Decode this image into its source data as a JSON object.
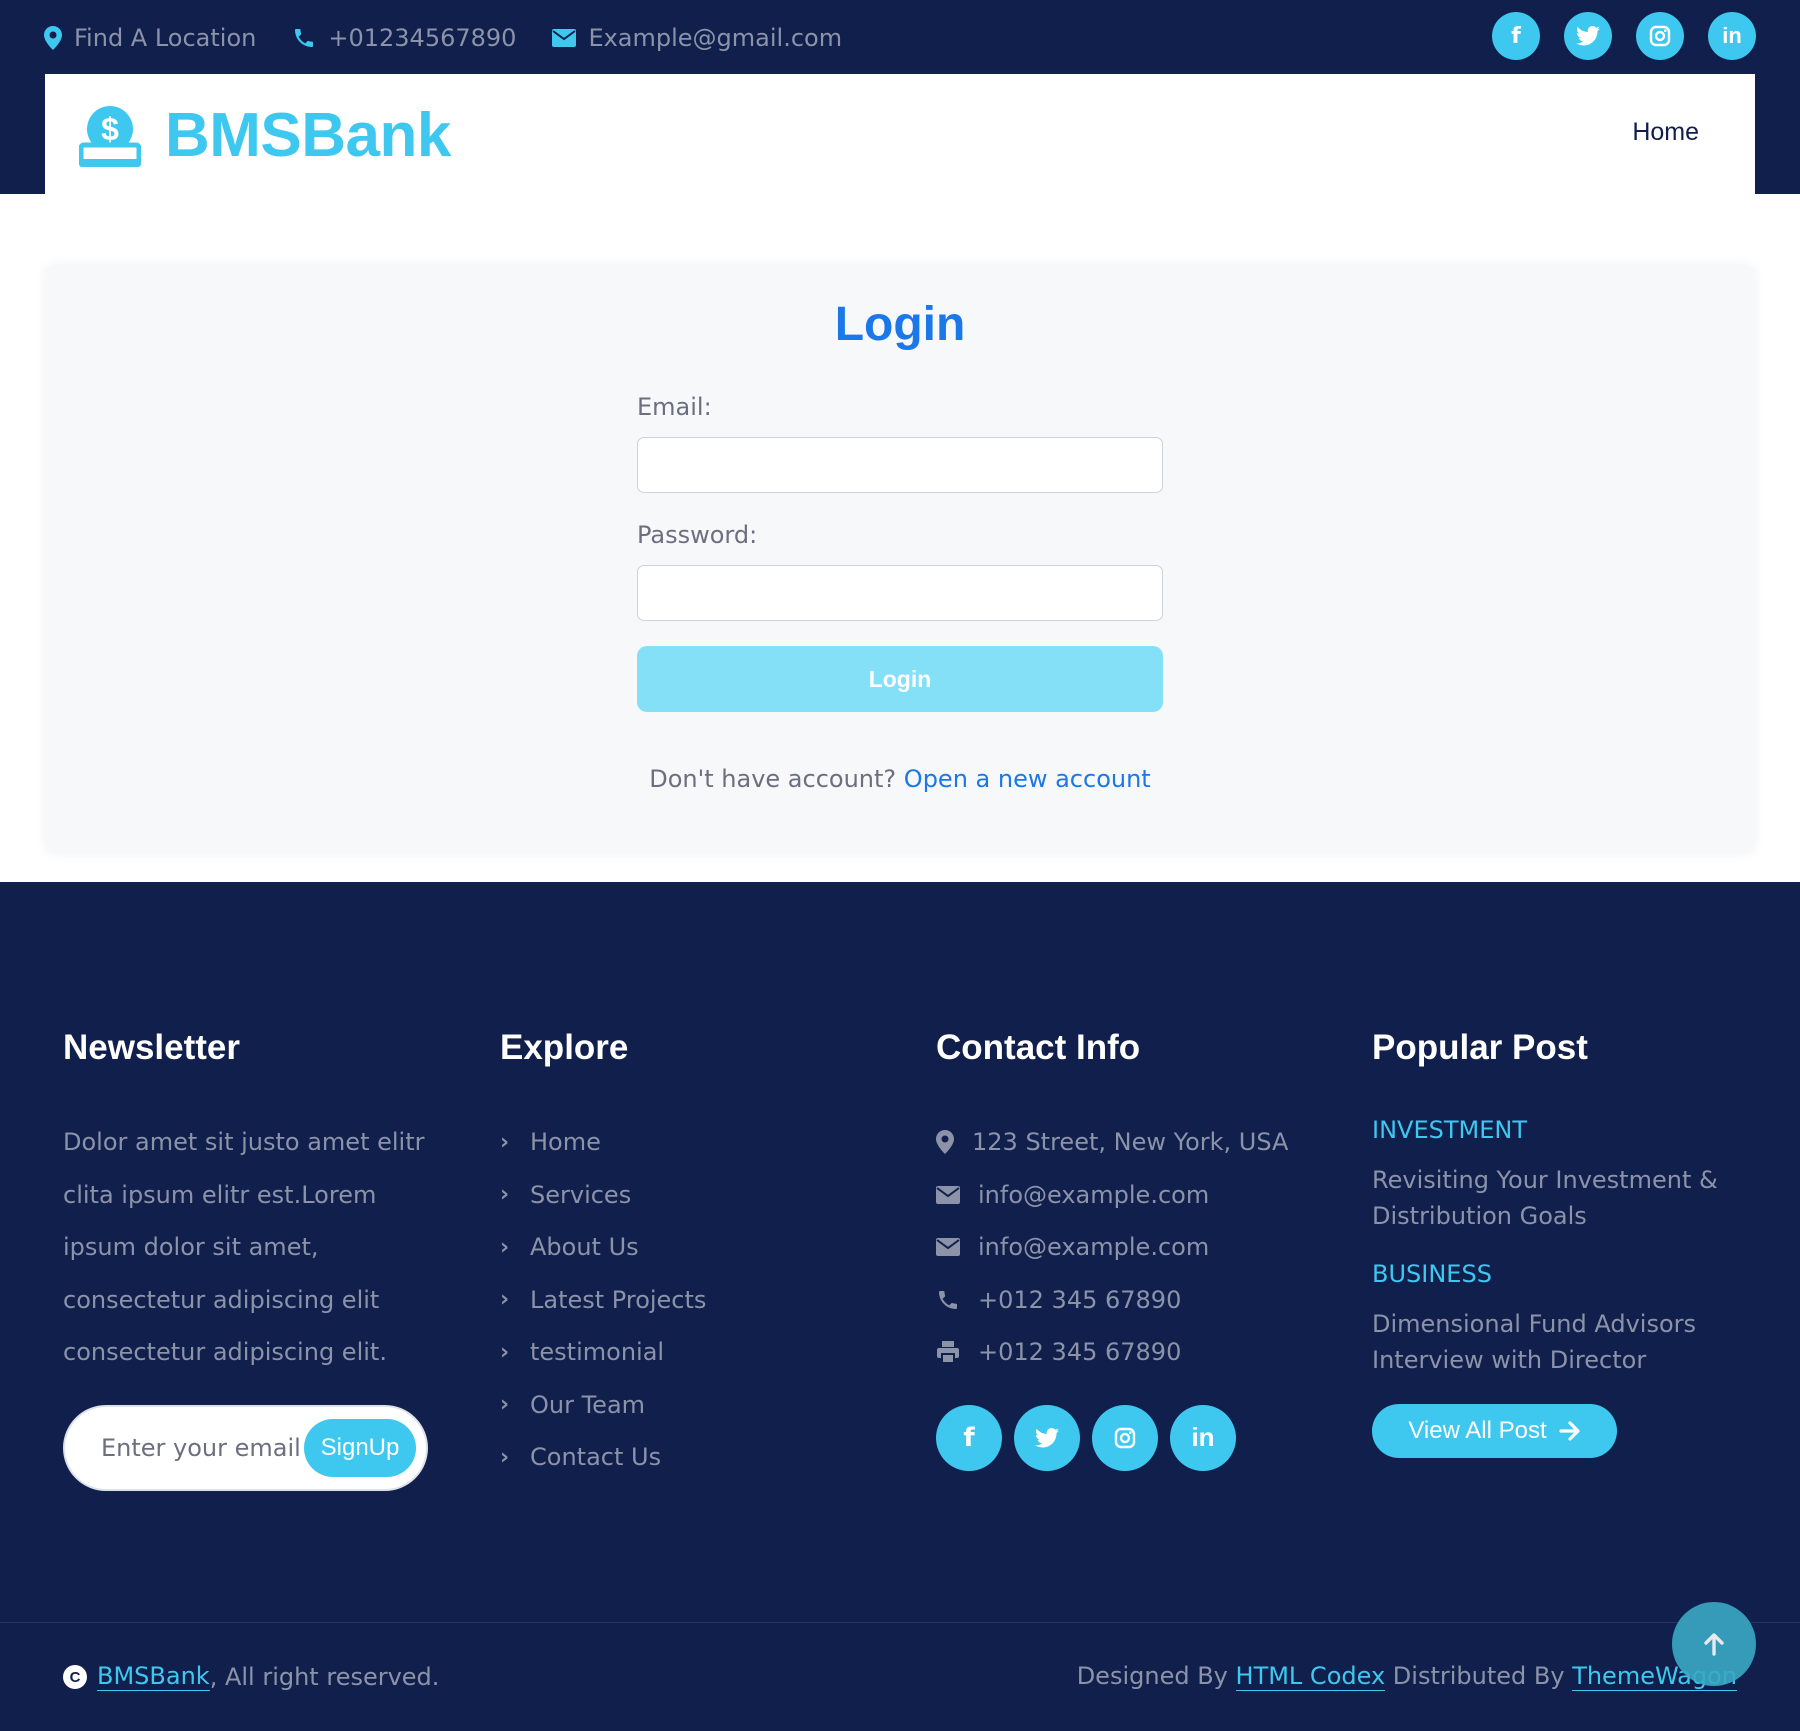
{
  "topbar": {
    "location": "Find A Location",
    "phone": "+01234567890",
    "email": "Example@gmail.com",
    "social": [
      "facebook-icon",
      "twitter-icon",
      "instagram-icon",
      "linkedin-icon"
    ]
  },
  "navbar": {
    "brand": "BMSBank",
    "home": "Home"
  },
  "login": {
    "title": "Login",
    "email_label": "Email:",
    "email_value": "",
    "password_label": "Password:",
    "password_value": "",
    "button": "Login",
    "no_account": "Don't have account?",
    "open_account": "Open a new account"
  },
  "footer": {
    "newsletter": {
      "title": "Newsletter",
      "text": "Dolor amet sit justo amet elitr clita ipsum elitr est.Lorem ipsum dolor sit amet, consectetur adipiscing elit consectetur adipiscing elit.",
      "placeholder": "Enter your email",
      "button": "SignUp"
    },
    "explore": {
      "title": "Explore",
      "items": [
        "Home",
        "Services",
        "About Us",
        "Latest Projects",
        "testimonial",
        "Our Team",
        "Contact Us"
      ]
    },
    "contact": {
      "title": "Contact Info",
      "address": "123 Street, New York, USA",
      "email1": "info@example.com",
      "email2": "info@example.com",
      "phone": "+012 345 67890",
      "fax": "+012 345 67890"
    },
    "posts": {
      "title": "Popular Post",
      "items": [
        {
          "category": "INVESTMENT",
          "title": "Revisiting Your Investment & Distribution Goals"
        },
        {
          "category": "BUSINESS",
          "title": "Dimensional Fund Advisors Interview with Director"
        }
      ],
      "button": "View All Post"
    },
    "copyright": {
      "brand": "BMSBank",
      "text": ", All right reserved."
    },
    "credits": {
      "designed_by": "Designed By",
      "designer": "HTML Codex",
      "distributed_by": "Distributed By",
      "distributor": "ThemeWagon"
    }
  },
  "colors": {
    "navy": "#101f4b",
    "accent": "#3ec8f0",
    "link": "#1a78e8"
  }
}
